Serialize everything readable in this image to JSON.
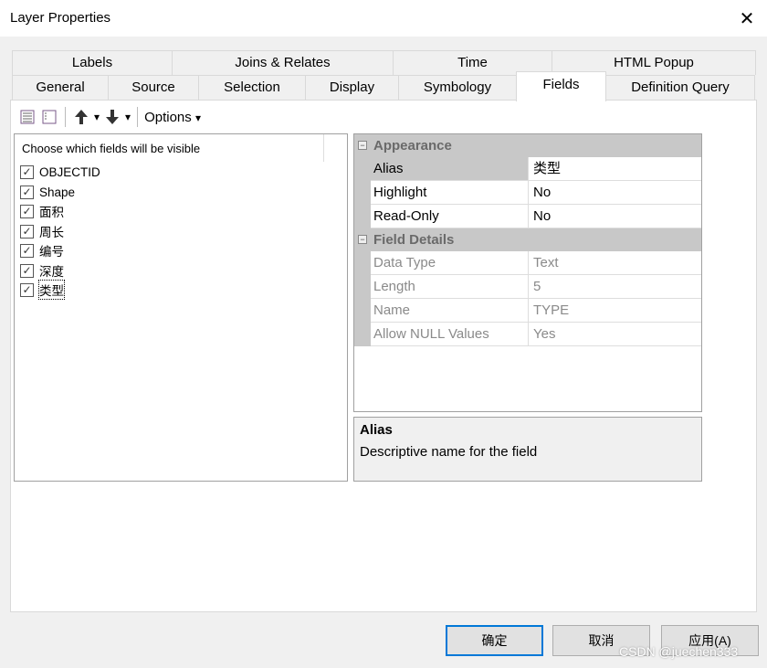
{
  "window": {
    "title": "Layer Properties",
    "close": "✕"
  },
  "tabs_row1": [
    "Labels",
    "Joins & Relates",
    "Time",
    "HTML Popup"
  ],
  "tabs_row2": [
    "General",
    "Source",
    "Selection",
    "Display",
    "Symbology",
    "Fields",
    "Definition Query"
  ],
  "selected_tab": "Fields",
  "toolbar": {
    "options_label": "Options",
    "caret": "▾",
    "up": "🡅",
    "down": "🡇"
  },
  "field_list": {
    "header": "Choose which fields will be visible",
    "check": "✓",
    "items": [
      {
        "name": "OBJECTID",
        "checked": true
      },
      {
        "name": "Shape",
        "checked": true
      },
      {
        "name": "面积",
        "checked": true
      },
      {
        "name": "周长",
        "checked": true
      },
      {
        "name": "编号",
        "checked": true
      },
      {
        "name": "深度",
        "checked": true
      },
      {
        "name": "类型",
        "checked": true
      }
    ]
  },
  "properties": {
    "appearance": {
      "title": "Appearance",
      "rows": [
        {
          "label": "Alias",
          "value": "类型"
        },
        {
          "label": "Highlight",
          "value": "No"
        },
        {
          "label": "Read-Only",
          "value": "No"
        }
      ]
    },
    "field_details": {
      "title": "Field Details",
      "rows": [
        {
          "label": "Data Type",
          "value": "Text"
        },
        {
          "label": "Length",
          "value": "5"
        },
        {
          "label": "Name",
          "value": "TYPE"
        },
        {
          "label": "Allow NULL Values",
          "value": "Yes"
        }
      ]
    },
    "collapse": "−"
  },
  "description": {
    "title": "Alias",
    "text": "Descriptive name for the field"
  },
  "buttons": {
    "ok": "确定",
    "cancel": "取消",
    "apply": "应用(A)"
  },
  "watermark": "CSDN @juechen333"
}
